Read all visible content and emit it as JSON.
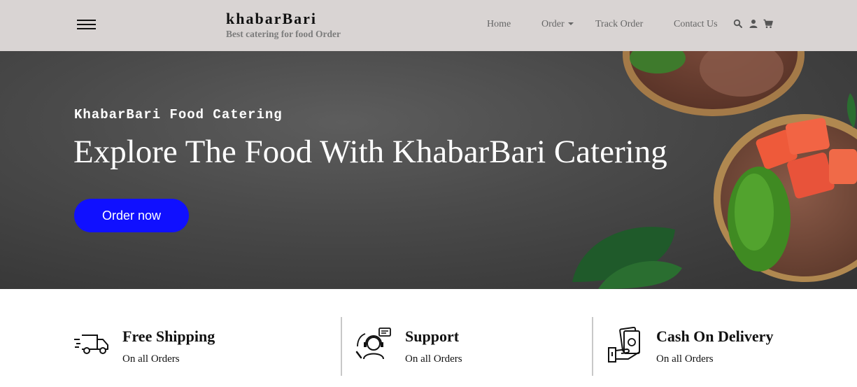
{
  "header": {
    "brand_name": "khabarBari",
    "brand_tagline": "Best catering for food Order",
    "nav": {
      "home": "Home",
      "order": "Order",
      "track": "Track Order",
      "contact": "Contact Us"
    },
    "icons": [
      "hamburger-menu-icon",
      "search-icon",
      "user-icon",
      "cart-icon"
    ]
  },
  "hero": {
    "kicker": "KhabarBari Food Catering",
    "title": "Explore The Food With KhabarBari Catering",
    "cta_label": "Order now",
    "cta_color": "#1010ff"
  },
  "features": [
    {
      "icon": "delivery-truck-icon",
      "title": "Free Shipping",
      "subtitle": "On all Orders"
    },
    {
      "icon": "support-agent-icon",
      "title": "Support",
      "subtitle": "On all Orders"
    },
    {
      "icon": "cash-money-icon",
      "title": "Cash On Delivery",
      "subtitle": "On all Orders"
    }
  ],
  "colors": {
    "header_bg": "#d9d4d3",
    "hero_bg": "#4a4a4a",
    "accent": "#1010ff"
  }
}
